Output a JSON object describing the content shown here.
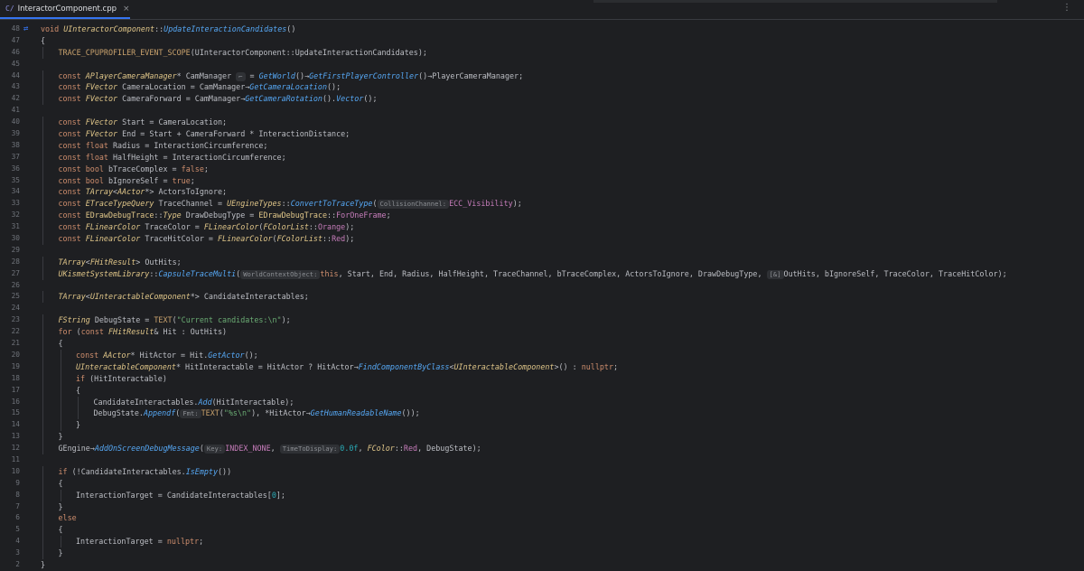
{
  "tab": {
    "icon": "C/",
    "title": "InteractorComponent.cpp",
    "close": "×"
  },
  "top_more": "⋮",
  "lines": [
    {
      "n": "48",
      "i": 0,
      "g": "⇄",
      "s": [
        [
          "kw",
          "void "
        ],
        [
          "cls",
          "UInteractorComponent"
        ],
        [
          "op",
          "::"
        ],
        [
          "fn",
          "UpdateInteractionCandidates"
        ],
        [
          "op",
          "()"
        ]
      ]
    },
    {
      "n": "47",
      "i": 0,
      "s": [
        [
          "op",
          "{"
        ]
      ]
    },
    {
      "n": "46",
      "i": 1,
      "s": [
        [
          "mac",
          "TRACE_CPUPROFILER_EVENT_SCOPE"
        ],
        [
          "op",
          "(UInteractorComponent::UpdateInteractionCandidates);"
        ]
      ]
    },
    {
      "n": "45",
      "i": 0,
      "s": []
    },
    {
      "n": "44",
      "i": 1,
      "s": [
        [
          "kw",
          "const "
        ],
        [
          "cls",
          "APlayerCameraManager"
        ],
        [
          "op",
          "* CamManager "
        ],
        [
          "hint",
          "⌐"
        ],
        [
          "op",
          " = "
        ],
        [
          "fn",
          "GetWorld"
        ],
        [
          "op",
          "()→"
        ],
        [
          "fn",
          "GetFirstPlayerController"
        ],
        [
          "op",
          "()→PlayerCameraManager;"
        ]
      ]
    },
    {
      "n": "43",
      "i": 1,
      "s": [
        [
          "kw",
          "const "
        ],
        [
          "cls",
          "FVector"
        ],
        [
          "op",
          " CameraLocation = CamManager→"
        ],
        [
          "fn",
          "GetCameraLocation"
        ],
        [
          "op",
          "();"
        ]
      ]
    },
    {
      "n": "42",
      "i": 1,
      "s": [
        [
          "kw",
          "const "
        ],
        [
          "cls",
          "FVector"
        ],
        [
          "op",
          " CameraForward = CamManager→"
        ],
        [
          "fn",
          "GetCameraRotation"
        ],
        [
          "op",
          "()."
        ],
        [
          "fn",
          "Vector"
        ],
        [
          "op",
          "();"
        ]
      ]
    },
    {
      "n": "41",
      "i": 0,
      "s": []
    },
    {
      "n": "40",
      "i": 1,
      "s": [
        [
          "kw",
          "const "
        ],
        [
          "cls",
          "FVector"
        ],
        [
          "op",
          " Start = CameraLocation;"
        ]
      ]
    },
    {
      "n": "39",
      "i": 1,
      "s": [
        [
          "kw",
          "const "
        ],
        [
          "cls",
          "FVector"
        ],
        [
          "op",
          " End = Start + CameraForward * InteractionDistance;"
        ]
      ]
    },
    {
      "n": "38",
      "i": 1,
      "s": [
        [
          "kw",
          "const float "
        ],
        [
          "op",
          "Radius = InteractionCircumference;"
        ]
      ]
    },
    {
      "n": "37",
      "i": 1,
      "s": [
        [
          "kw",
          "const float "
        ],
        [
          "op",
          "HalfHeight = InteractionCircumference;"
        ]
      ]
    },
    {
      "n": "36",
      "i": 1,
      "s": [
        [
          "kw",
          "const bool "
        ],
        [
          "op",
          "bTraceComplex = "
        ],
        [
          "kw",
          "false"
        ],
        [
          "op",
          ";"
        ]
      ]
    },
    {
      "n": "35",
      "i": 1,
      "s": [
        [
          "kw",
          "const bool "
        ],
        [
          "op",
          "bIgnoreSelf = "
        ],
        [
          "kw",
          "true"
        ],
        [
          "op",
          ";"
        ]
      ]
    },
    {
      "n": "34",
      "i": 1,
      "s": [
        [
          "kw",
          "const "
        ],
        [
          "cls",
          "TArray"
        ],
        [
          "op",
          "<"
        ],
        [
          "cls",
          "AActor"
        ],
        [
          "op",
          "*> ActorsToIgnore;"
        ]
      ]
    },
    {
      "n": "33",
      "i": 1,
      "s": [
        [
          "kw",
          "const "
        ],
        [
          "cls",
          "ETraceTypeQuery"
        ],
        [
          "op",
          " TraceChannel = "
        ],
        [
          "cls",
          "UEngineTypes"
        ],
        [
          "op",
          "::"
        ],
        [
          "fn",
          "ConvertToTraceType"
        ],
        [
          "op",
          "("
        ],
        [
          "hint",
          "CollisionChannel:"
        ],
        [
          "en",
          "ECC_Visibility"
        ],
        [
          "op",
          ");"
        ]
      ]
    },
    {
      "n": "32",
      "i": 1,
      "s": [
        [
          "kw",
          "const "
        ],
        [
          "cls2",
          "EDrawDebugTrace"
        ],
        [
          "op",
          "::"
        ],
        [
          "cls",
          "Type"
        ],
        [
          "op",
          " DrawDebugType = "
        ],
        [
          "cls2",
          "EDrawDebugTrace"
        ],
        [
          "op",
          "::"
        ],
        [
          "en",
          "ForOneFrame"
        ],
        [
          "op",
          ";"
        ]
      ]
    },
    {
      "n": "31",
      "i": 1,
      "s": [
        [
          "kw",
          "const "
        ],
        [
          "cls",
          "FLinearColor"
        ],
        [
          "op",
          " TraceColor = "
        ],
        [
          "cls",
          "FLinearColor"
        ],
        [
          "op",
          "("
        ],
        [
          "cls",
          "FColorList"
        ],
        [
          "op",
          "::"
        ],
        [
          "en",
          "Orange"
        ],
        [
          "op",
          ");"
        ]
      ]
    },
    {
      "n": "30",
      "i": 1,
      "s": [
        [
          "kw",
          "const "
        ],
        [
          "cls",
          "FLinearColor"
        ],
        [
          "op",
          " TraceHitColor = "
        ],
        [
          "cls",
          "FLinearColor"
        ],
        [
          "op",
          "("
        ],
        [
          "cls",
          "FColorList"
        ],
        [
          "op",
          "::"
        ],
        [
          "en",
          "Red"
        ],
        [
          "op",
          ");"
        ]
      ]
    },
    {
      "n": "29",
      "i": 0,
      "s": []
    },
    {
      "n": "28",
      "i": 1,
      "s": [
        [
          "cls",
          "TArray"
        ],
        [
          "op",
          "<"
        ],
        [
          "cls",
          "FHitResult"
        ],
        [
          "op",
          "> OutHits;"
        ]
      ]
    },
    {
      "n": "27",
      "i": 1,
      "s": [
        [
          "cls",
          "UKismetSystemLibrary"
        ],
        [
          "op",
          "::"
        ],
        [
          "fn",
          "CapsuleTraceMulti"
        ],
        [
          "op",
          "("
        ],
        [
          "hint",
          "WorldContextObject:"
        ],
        [
          "kw",
          "this"
        ],
        [
          "op",
          ", Start, End, Radius, HalfHeight, TraceChannel, bTraceComplex, ActorsToIgnore, DrawDebugType, "
        ],
        [
          "hint",
          "[&]"
        ],
        [
          "op",
          "OutHits, bIgnoreSelf, TraceColor, TraceHitColor);"
        ]
      ]
    },
    {
      "n": "26",
      "i": 0,
      "s": []
    },
    {
      "n": "25",
      "i": 1,
      "s": [
        [
          "cls",
          "TArray"
        ],
        [
          "op",
          "<"
        ],
        [
          "cls",
          "UInteractableComponent"
        ],
        [
          "op",
          "*> CandidateInteractables;"
        ]
      ]
    },
    {
      "n": "24",
      "i": 0,
      "s": []
    },
    {
      "n": "23",
      "i": 1,
      "s": [
        [
          "cls",
          "FString"
        ],
        [
          "op",
          " DebugState = "
        ],
        [
          "mac",
          "TEXT"
        ],
        [
          "op",
          "("
        ],
        [
          "str",
          "\"Current candidates:\\n\""
        ],
        [
          "op",
          ");"
        ]
      ]
    },
    {
      "n": "22",
      "i": 1,
      "s": [
        [
          "kw",
          "for "
        ],
        [
          "op",
          "("
        ],
        [
          "kw",
          "const "
        ],
        [
          "cls",
          "FHitResult"
        ],
        [
          "op",
          "& Hit : OutHits)"
        ]
      ]
    },
    {
      "n": "21",
      "i": 1,
      "s": [
        [
          "op",
          "{"
        ]
      ]
    },
    {
      "n": "20",
      "i": 2,
      "s": [
        [
          "kw",
          "const "
        ],
        [
          "cls",
          "AActor"
        ],
        [
          "op",
          "* HitActor = Hit."
        ],
        [
          "fn",
          "GetActor"
        ],
        [
          "op",
          "();"
        ]
      ]
    },
    {
      "n": "19",
      "i": 2,
      "s": [
        [
          "cls",
          "UInteractableComponent"
        ],
        [
          "op",
          "* HitInteractable = HitActor ? HitActor→"
        ],
        [
          "fn",
          "FindComponentByClass"
        ],
        [
          "op",
          "<"
        ],
        [
          "cls",
          "UInteractableComponent"
        ],
        [
          "op",
          ">() : "
        ],
        [
          "kw",
          "nullptr"
        ],
        [
          "op",
          ";"
        ]
      ]
    },
    {
      "n": "18",
      "i": 2,
      "s": [
        [
          "kw",
          "if "
        ],
        [
          "op",
          "(HitInteractable)"
        ]
      ]
    },
    {
      "n": "17",
      "i": 2,
      "s": [
        [
          "op",
          "{"
        ]
      ]
    },
    {
      "n": "16",
      "i": 3,
      "s": [
        [
          "op",
          "CandidateInteractables."
        ],
        [
          "fn",
          "Add"
        ],
        [
          "op",
          "(HitInteractable);"
        ]
      ]
    },
    {
      "n": "15",
      "i": 3,
      "s": [
        [
          "op",
          "DebugState."
        ],
        [
          "fn",
          "Appendf"
        ],
        [
          "op",
          "("
        ],
        [
          "hint",
          "Fmt:"
        ],
        [
          "mac",
          "TEXT"
        ],
        [
          "op",
          "("
        ],
        [
          "str",
          "\"%s\\n\""
        ],
        [
          "op",
          "), *HitActor→"
        ],
        [
          "fn",
          "GetHumanReadableName"
        ],
        [
          "op",
          "());"
        ]
      ]
    },
    {
      "n": "14",
      "i": 2,
      "s": [
        [
          "op",
          "}"
        ]
      ]
    },
    {
      "n": "13",
      "i": 1,
      "s": [
        [
          "op",
          "}"
        ]
      ]
    },
    {
      "n": "12",
      "i": 1,
      "s": [
        [
          "op",
          "GEngine→"
        ],
        [
          "fn",
          "AddOnScreenDebugMessage"
        ],
        [
          "op",
          "("
        ],
        [
          "hint",
          "Key:"
        ],
        [
          "en",
          "INDEX_NONE"
        ],
        [
          "op",
          ", "
        ],
        [
          "hint",
          "TimeToDisplay:"
        ],
        [
          "num",
          "0.0f"
        ],
        [
          "op",
          ", "
        ],
        [
          "cls",
          "FColor"
        ],
        [
          "op",
          "::"
        ],
        [
          "en",
          "Red"
        ],
        [
          "op",
          ", DebugState);"
        ]
      ]
    },
    {
      "n": "11",
      "i": 0,
      "s": []
    },
    {
      "n": "10",
      "i": 1,
      "s": [
        [
          "kw",
          "if "
        ],
        [
          "op",
          "(!CandidateInteractables."
        ],
        [
          "fn",
          "IsEmpty"
        ],
        [
          "op",
          "())"
        ]
      ]
    },
    {
      "n": "9",
      "i": 1,
      "s": [
        [
          "op",
          "{"
        ]
      ]
    },
    {
      "n": "8",
      "i": 2,
      "s": [
        [
          "op",
          "InteractionTarget = CandidateInteractables["
        ],
        [
          "num",
          "0"
        ],
        [
          "op",
          "];"
        ]
      ]
    },
    {
      "n": "7",
      "i": 1,
      "s": [
        [
          "op",
          "}"
        ]
      ]
    },
    {
      "n": "6",
      "i": 1,
      "s": [
        [
          "kw",
          "else"
        ]
      ]
    },
    {
      "n": "5",
      "i": 1,
      "s": [
        [
          "op",
          "{"
        ]
      ]
    },
    {
      "n": "4",
      "i": 2,
      "s": [
        [
          "op",
          "InteractionTarget = "
        ],
        [
          "kw",
          "nullptr"
        ],
        [
          "op",
          ";"
        ]
      ]
    },
    {
      "n": "3",
      "i": 1,
      "s": [
        [
          "op",
          "}"
        ]
      ]
    },
    {
      "n": "2",
      "i": 0,
      "s": [
        [
          "op",
          "}"
        ]
      ]
    }
  ]
}
